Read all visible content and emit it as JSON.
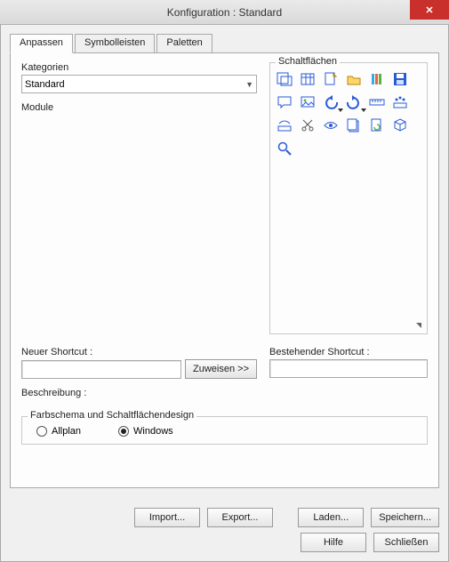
{
  "window": {
    "title": "Konfiguration :  Standard"
  },
  "tabs": {
    "t0": "Anpassen",
    "t1": "Symbolleisten",
    "t2": "Paletten"
  },
  "labels": {
    "categories": "Kategorien",
    "modules": "Module",
    "buttons_group": "Schaltflächen",
    "new_shortcut": "Neuer Shortcut :",
    "existing_shortcut": "Bestehender Shortcut :",
    "assign": "Zuweisen >>",
    "description": "Beschreibung :",
    "design_group": "Farbschema und Schaltflächendesign"
  },
  "category_select": {
    "value": "Standard"
  },
  "shortcut": {
    "new_value": "",
    "existing_value": ""
  },
  "design": {
    "option_allplan": "Allplan",
    "option_windows": "Windows",
    "selected": "windows"
  },
  "buttons": {
    "import": "Import...",
    "export": "Export...",
    "load": "Laden...",
    "save": "Speichern...",
    "help": "Hilfe",
    "close": "Schließen"
  },
  "toolbar_icons": [
    "window-config-icon",
    "calendar-grid-icon",
    "new-page-icon",
    "folder-open-icon",
    "color-bars-icon",
    "save-disk-icon",
    "speech-bubble-icon",
    "picture-icon",
    "undo-arrow-icon",
    "redo-arrow-icon",
    "ruler-icon",
    "edit-points-icon",
    "edit-spline-icon",
    "scissors-icon",
    "eye-view-icon",
    "page-shadow-icon",
    "page-refresh-icon",
    "cube-3d-icon",
    "magnifier-icon"
  ]
}
